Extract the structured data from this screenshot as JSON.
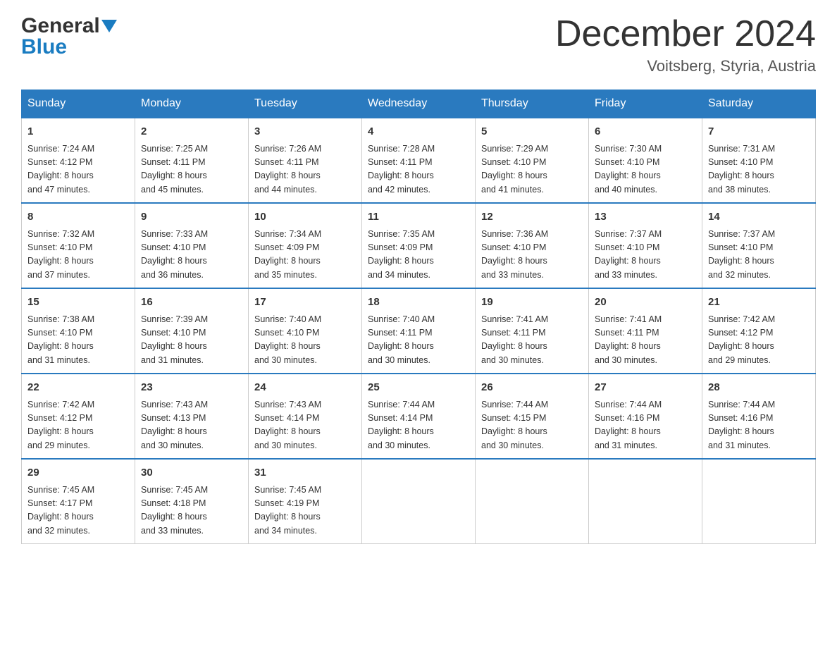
{
  "header": {
    "logo_general": "General",
    "logo_blue": "Blue",
    "month_title": "December 2024",
    "location": "Voitsberg, Styria, Austria"
  },
  "days_of_week": [
    "Sunday",
    "Monday",
    "Tuesday",
    "Wednesday",
    "Thursday",
    "Friday",
    "Saturday"
  ],
  "weeks": [
    [
      {
        "day": "1",
        "sunrise": "7:24 AM",
        "sunset": "4:12 PM",
        "daylight": "8 hours and 47 minutes."
      },
      {
        "day": "2",
        "sunrise": "7:25 AM",
        "sunset": "4:11 PM",
        "daylight": "8 hours and 45 minutes."
      },
      {
        "day": "3",
        "sunrise": "7:26 AM",
        "sunset": "4:11 PM",
        "daylight": "8 hours and 44 minutes."
      },
      {
        "day": "4",
        "sunrise": "7:28 AM",
        "sunset": "4:11 PM",
        "daylight": "8 hours and 42 minutes."
      },
      {
        "day": "5",
        "sunrise": "7:29 AM",
        "sunset": "4:10 PM",
        "daylight": "8 hours and 41 minutes."
      },
      {
        "day": "6",
        "sunrise": "7:30 AM",
        "sunset": "4:10 PM",
        "daylight": "8 hours and 40 minutes."
      },
      {
        "day": "7",
        "sunrise": "7:31 AM",
        "sunset": "4:10 PM",
        "daylight": "8 hours and 38 minutes."
      }
    ],
    [
      {
        "day": "8",
        "sunrise": "7:32 AM",
        "sunset": "4:10 PM",
        "daylight": "8 hours and 37 minutes."
      },
      {
        "day": "9",
        "sunrise": "7:33 AM",
        "sunset": "4:10 PM",
        "daylight": "8 hours and 36 minutes."
      },
      {
        "day": "10",
        "sunrise": "7:34 AM",
        "sunset": "4:09 PM",
        "daylight": "8 hours and 35 minutes."
      },
      {
        "day": "11",
        "sunrise": "7:35 AM",
        "sunset": "4:09 PM",
        "daylight": "8 hours and 34 minutes."
      },
      {
        "day": "12",
        "sunrise": "7:36 AM",
        "sunset": "4:10 PM",
        "daylight": "8 hours and 33 minutes."
      },
      {
        "day": "13",
        "sunrise": "7:37 AM",
        "sunset": "4:10 PM",
        "daylight": "8 hours and 33 minutes."
      },
      {
        "day": "14",
        "sunrise": "7:37 AM",
        "sunset": "4:10 PM",
        "daylight": "8 hours and 32 minutes."
      }
    ],
    [
      {
        "day": "15",
        "sunrise": "7:38 AM",
        "sunset": "4:10 PM",
        "daylight": "8 hours and 31 minutes."
      },
      {
        "day": "16",
        "sunrise": "7:39 AM",
        "sunset": "4:10 PM",
        "daylight": "8 hours and 31 minutes."
      },
      {
        "day": "17",
        "sunrise": "7:40 AM",
        "sunset": "4:10 PM",
        "daylight": "8 hours and 30 minutes."
      },
      {
        "day": "18",
        "sunrise": "7:40 AM",
        "sunset": "4:11 PM",
        "daylight": "8 hours and 30 minutes."
      },
      {
        "day": "19",
        "sunrise": "7:41 AM",
        "sunset": "4:11 PM",
        "daylight": "8 hours and 30 minutes."
      },
      {
        "day": "20",
        "sunrise": "7:41 AM",
        "sunset": "4:11 PM",
        "daylight": "8 hours and 30 minutes."
      },
      {
        "day": "21",
        "sunrise": "7:42 AM",
        "sunset": "4:12 PM",
        "daylight": "8 hours and 29 minutes."
      }
    ],
    [
      {
        "day": "22",
        "sunrise": "7:42 AM",
        "sunset": "4:12 PM",
        "daylight": "8 hours and 29 minutes."
      },
      {
        "day": "23",
        "sunrise": "7:43 AM",
        "sunset": "4:13 PM",
        "daylight": "8 hours and 30 minutes."
      },
      {
        "day": "24",
        "sunrise": "7:43 AM",
        "sunset": "4:14 PM",
        "daylight": "8 hours and 30 minutes."
      },
      {
        "day": "25",
        "sunrise": "7:44 AM",
        "sunset": "4:14 PM",
        "daylight": "8 hours and 30 minutes."
      },
      {
        "day": "26",
        "sunrise": "7:44 AM",
        "sunset": "4:15 PM",
        "daylight": "8 hours and 30 minutes."
      },
      {
        "day": "27",
        "sunrise": "7:44 AM",
        "sunset": "4:16 PM",
        "daylight": "8 hours and 31 minutes."
      },
      {
        "day": "28",
        "sunrise": "7:44 AM",
        "sunset": "4:16 PM",
        "daylight": "8 hours and 31 minutes."
      }
    ],
    [
      {
        "day": "29",
        "sunrise": "7:45 AM",
        "sunset": "4:17 PM",
        "daylight": "8 hours and 32 minutes."
      },
      {
        "day": "30",
        "sunrise": "7:45 AM",
        "sunset": "4:18 PM",
        "daylight": "8 hours and 33 minutes."
      },
      {
        "day": "31",
        "sunrise": "7:45 AM",
        "sunset": "4:19 PM",
        "daylight": "8 hours and 34 minutes."
      },
      null,
      null,
      null,
      null
    ]
  ],
  "labels": {
    "sunrise": "Sunrise:",
    "sunset": "Sunset:",
    "daylight": "Daylight:"
  }
}
